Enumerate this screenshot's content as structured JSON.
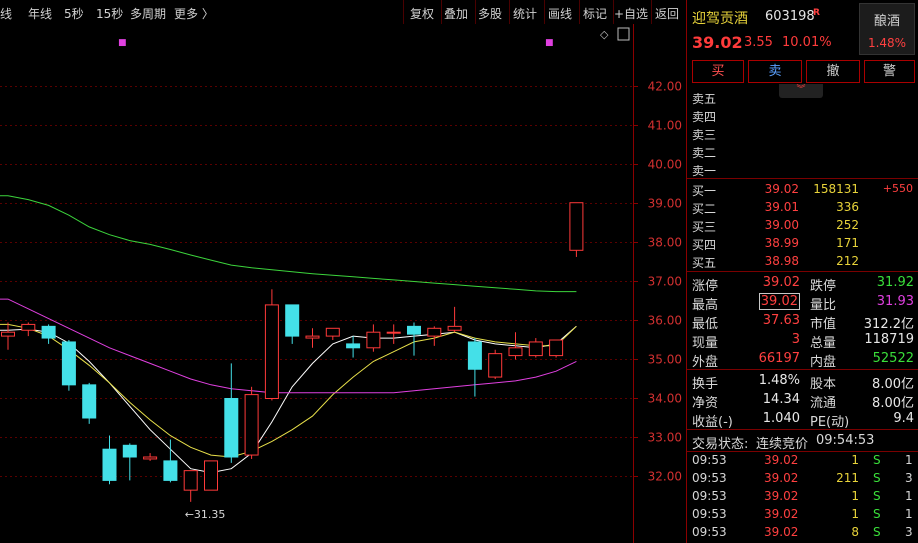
{
  "toolbar": {
    "left": [
      "年线",
      "5秒",
      "15秒",
      "多周期",
      "更多 〉"
    ],
    "left_cut": "季线",
    "right": [
      "复权",
      "叠加",
      "多股",
      "统计",
      "画线",
      "标记",
      "+自选",
      "返回"
    ]
  },
  "chart_data": {
    "type": "candlestick",
    "title": "",
    "y_ticks": [
      42.0,
      41.0,
      40.0,
      39.0,
      38.0,
      37.0,
      36.0,
      35.0,
      34.0,
      33.0,
      32.0
    ],
    "ylim": [
      31.0,
      42.9
    ],
    "grid": "horizontal dotted",
    "low_annotation": "←31.35",
    "candles": [
      {
        "o": 35.6,
        "h": 35.95,
        "l": 35.25,
        "c": 35.7
      },
      {
        "o": 35.75,
        "h": 35.95,
        "l": 35.6,
        "c": 35.9
      },
      {
        "o": 35.85,
        "h": 35.9,
        "l": 35.4,
        "c": 35.55
      },
      {
        "o": 35.45,
        "h": 35.5,
        "l": 34.2,
        "c": 34.35
      },
      {
        "o": 34.35,
        "h": 34.4,
        "l": 33.35,
        "c": 33.5
      },
      {
        "o": 32.7,
        "h": 33.05,
        "l": 31.8,
        "c": 31.9
      },
      {
        "o": 32.8,
        "h": 32.85,
        "l": 31.9,
        "c": 32.5
      },
      {
        "o": 32.45,
        "h": 32.6,
        "l": 32.4,
        "c": 32.5
      },
      {
        "o": 32.4,
        "h": 32.95,
        "l": 31.85,
        "c": 31.9
      },
      {
        "o": 31.65,
        "h": 31.85,
        "l": 31.35,
        "c": 32.15
      },
      {
        "o": 31.65,
        "h": 32.35,
        "l": 31.65,
        "c": 32.4
      },
      {
        "o": 34.0,
        "h": 34.9,
        "l": 32.35,
        "c": 32.5
      },
      {
        "o": 32.55,
        "h": 34.3,
        "l": 32.45,
        "c": 34.1
      },
      {
        "o": 34.0,
        "h": 36.8,
        "l": 33.95,
        "c": 36.4
      },
      {
        "o": 36.4,
        "h": 36.4,
        "l": 35.4,
        "c": 35.6
      },
      {
        "o": 35.55,
        "h": 35.8,
        "l": 35.3,
        "c": 35.6
      },
      {
        "o": 35.6,
        "h": 35.8,
        "l": 35.5,
        "c": 35.8
      },
      {
        "o": 35.4,
        "h": 35.6,
        "l": 35.05,
        "c": 35.3
      },
      {
        "o": 35.3,
        "h": 35.9,
        "l": 35.2,
        "c": 35.7
      },
      {
        "o": 35.7,
        "h": 35.9,
        "l": 35.4,
        "c": 35.7
      },
      {
        "o": 35.85,
        "h": 35.95,
        "l": 35.1,
        "c": 35.65
      },
      {
        "o": 35.6,
        "h": 35.85,
        "l": 35.35,
        "c": 35.8
      },
      {
        "o": 35.75,
        "h": 36.35,
        "l": 35.7,
        "c": 35.85
      },
      {
        "o": 35.45,
        "h": 35.55,
        "l": 34.05,
        "c": 34.75
      },
      {
        "o": 34.55,
        "h": 35.25,
        "l": 34.5,
        "c": 35.15
      },
      {
        "o": 35.1,
        "h": 35.7,
        "l": 35.0,
        "c": 35.3
      },
      {
        "o": 35.1,
        "h": 35.55,
        "l": 35.05,
        "c": 35.45
      },
      {
        "o": 35.1,
        "h": 35.5,
        "l": 35.05,
        "c": 35.5
      },
      {
        "o": 37.8,
        "h": 39.02,
        "l": 37.63,
        "c": 39.02
      }
    ],
    "ma_lines": [
      {
        "color": "#ffffff",
        "values": [
          35.75,
          35.78,
          35.7,
          35.42,
          34.95,
          34.4,
          33.8,
          33.2,
          32.7,
          32.2,
          32.1,
          32.2,
          32.6,
          33.4,
          34.3,
          34.9,
          35.4,
          35.6,
          35.55,
          35.55,
          35.6,
          35.65,
          35.7,
          35.5,
          35.4,
          35.35,
          35.3,
          35.4,
          35.85
        ]
      },
      {
        "color": "#e8e04a",
        "values": [
          35.9,
          35.8,
          35.6,
          35.25,
          34.85,
          34.4,
          33.9,
          33.45,
          33.05,
          32.75,
          32.55,
          32.5,
          32.65,
          32.9,
          33.2,
          33.55,
          34.1,
          34.55,
          34.95,
          35.2,
          35.45,
          35.55,
          35.7,
          35.55,
          35.45,
          35.4,
          35.35,
          35.35,
          35.85
        ]
      },
      {
        "color": "#e040e0",
        "values": [
          36.55,
          36.3,
          36.05,
          35.8,
          35.55,
          35.3,
          35.1,
          34.9,
          34.7,
          34.5,
          34.35,
          34.25,
          34.2,
          34.15,
          34.15,
          34.15,
          34.15,
          34.15,
          34.15,
          34.15,
          34.2,
          34.25,
          34.3,
          34.35,
          34.4,
          34.45,
          34.55,
          34.7,
          34.95
        ]
      },
      {
        "color": "#3cd43c",
        "values": [
          39.2,
          39.1,
          38.95,
          38.7,
          38.4,
          38.2,
          38.05,
          37.95,
          37.82,
          37.68,
          37.55,
          37.42,
          37.35,
          37.3,
          37.25,
          37.2,
          37.16,
          37.12,
          37.08,
          37.04,
          37.0,
          36.96,
          36.92,
          36.88,
          36.84,
          36.8,
          36.76,
          36.74,
          36.74
        ]
      }
    ]
  },
  "quote": {
    "name": "迎驾贡酒",
    "code": "603198",
    "r_mark": "R",
    "sector": "酿酒",
    "sector_pct": "1.48%",
    "price": "39.02",
    "change": "3.55",
    "change_pct": "10.01%"
  },
  "buttons": {
    "buy": "买",
    "sell": "卖",
    "cancel": "撤",
    "alert": "警"
  },
  "collapse_icon": "chevron-down",
  "asks": [
    {
      "label": "卖五"
    },
    {
      "label": "卖四"
    },
    {
      "label": "卖三"
    },
    {
      "label": "卖二"
    },
    {
      "label": "卖一"
    }
  ],
  "bids": [
    {
      "label": "买一",
      "price": "39.02",
      "vol": "158131",
      "delta": "+550"
    },
    {
      "label": "买二",
      "price": "39.01",
      "vol": "336",
      "delta": ""
    },
    {
      "label": "买三",
      "price": "39.00",
      "vol": "252",
      "delta": ""
    },
    {
      "label": "买四",
      "price": "38.99",
      "vol": "171",
      "delta": ""
    },
    {
      "label": "买五",
      "price": "38.98",
      "vol": "212",
      "delta": ""
    }
  ],
  "stats_a": [
    {
      "l1": "涨停",
      "v1": "39.02",
      "c1": "red",
      "l2": "跌停",
      "v2": "31.92",
      "c2": "green"
    },
    {
      "l1": "最高",
      "v1": "39.02",
      "c1": "red",
      "l2": "量比",
      "v2": "31.93",
      "c2": "mag",
      "boxed": true
    },
    {
      "l1": "最低",
      "v1": "37.63",
      "c1": "red",
      "l2": "市值",
      "v2": "312.2亿",
      "c2": "wht"
    },
    {
      "l1": "现量",
      "v1": "3",
      "c1": "red",
      "l2": "总量",
      "v2": "118719",
      "c2": "wht"
    },
    {
      "l1": "外盘",
      "v1": "66197",
      "c1": "red",
      "l2": "内盘",
      "v2": "52522",
      "c2": "green"
    }
  ],
  "stats_b": [
    {
      "l1": "换手",
      "v1": "1.48%",
      "l2": "股本",
      "v2": "8.00亿"
    },
    {
      "l1": "净资",
      "v1": "14.34",
      "l2": "流通",
      "v2": "8.00亿"
    },
    {
      "l1": "收益(-)",
      "v1": "1.040",
      "l2": "PE(动)",
      "v2": "9.4"
    }
  ],
  "trade_status": {
    "label": "交易状态:",
    "value": "连续竞价",
    "time": "09:54:53"
  },
  "trades": [
    {
      "time": "09:53",
      "price": "39.02",
      "vol": "1",
      "side": "S",
      "n": "1"
    },
    {
      "time": "09:53",
      "price": "39.02",
      "vol": "211",
      "side": "S",
      "n": "3"
    },
    {
      "time": "09:53",
      "price": "39.02",
      "vol": "1",
      "side": "S",
      "n": "1"
    },
    {
      "time": "09:53",
      "price": "39.02",
      "vol": "1",
      "side": "S",
      "n": "1"
    },
    {
      "time": "09:53",
      "price": "39.02",
      "vol": "8",
      "side": "S",
      "n": "3"
    }
  ]
}
